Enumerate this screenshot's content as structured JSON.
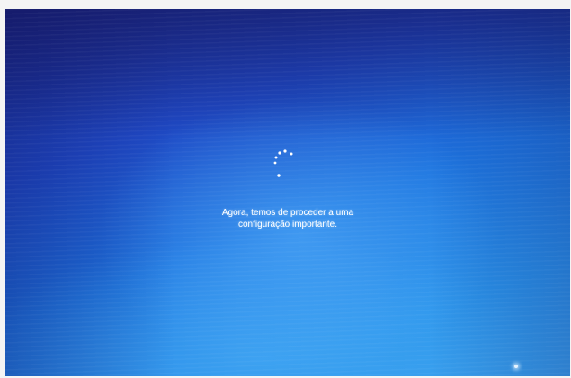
{
  "setup_screen": {
    "message_line1": "Agora, temos de proceder a uma",
    "message_line2": "configuração importante."
  },
  "icons": {
    "spinner": "loading-spinner-icon"
  },
  "colors": {
    "background_dark": "#1c2a8c",
    "background_mid": "#1d73de",
    "background_light": "#3aa3ee",
    "text": "#ffffff"
  }
}
